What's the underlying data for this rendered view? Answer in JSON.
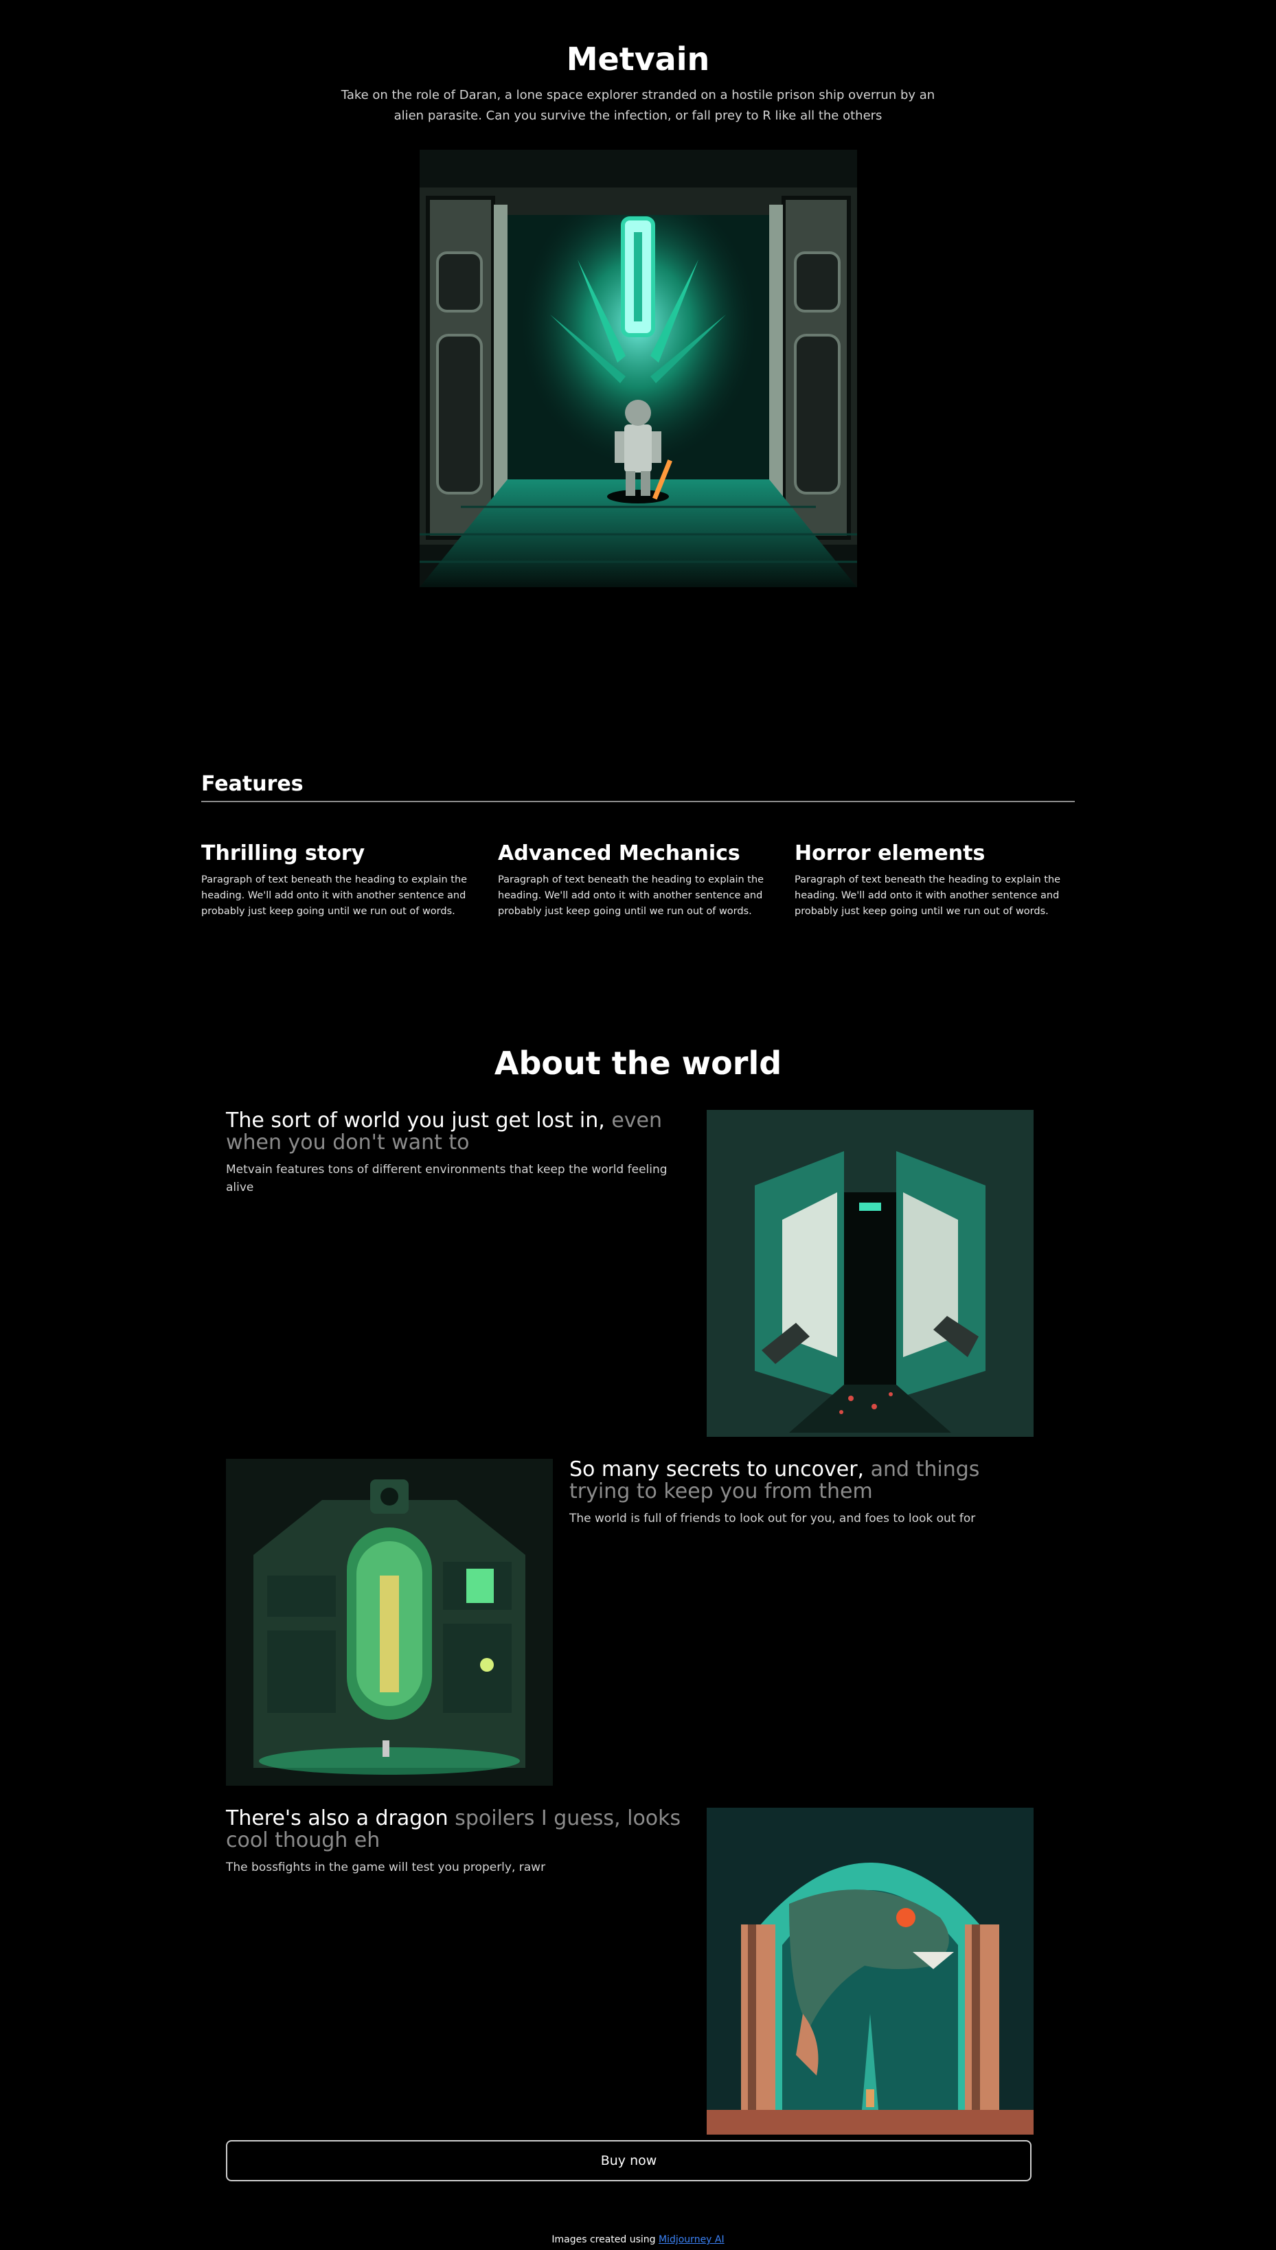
{
  "hero": {
    "title": "Metvain",
    "subtitle": "Take on the role of Daran, a lone space explorer stranded on a hostile prison ship overrun by an alien parasite. Can you survive the infection, or fall prey to R like all the others"
  },
  "features": {
    "heading": "Features",
    "items": [
      {
        "title": "Thrilling story",
        "text": "Paragraph of text beneath the heading to explain the heading. We'll add onto it with another sentence and probably just keep going until we run out of words."
      },
      {
        "title": "Advanced Mechanics",
        "text": "Paragraph of text beneath the heading to explain the heading. We'll add onto it with another sentence and probably just keep going until we run out of words."
      },
      {
        "title": "Horror elements",
        "text": "Paragraph of text beneath the heading to explain the heading. We'll add onto it with another sentence and probably just keep going until we run out of words."
      }
    ]
  },
  "about": {
    "title": "About the world",
    "rows": [
      {
        "heading": "The sort of world you just get lost in,",
        "heading_muted": "even when you don't want to",
        "text": "Metvain features tons of different environments that keep the world feeling alive"
      },
      {
        "heading": "So many secrets to uncover,",
        "heading_muted": "and things trying to keep you from them",
        "text": "The world is full of friends to look out for you, and foes to look out for"
      },
      {
        "heading": "There's also a dragon",
        "heading_muted": "spoilers I guess, looks cool though eh",
        "text": "The bossfights in the game will test you properly, rawr"
      }
    ]
  },
  "buy": {
    "label": "Buy now"
  },
  "footer": {
    "prefix": "Images created using",
    "link": "Midjourney AI"
  },
  "colors": {
    "background": "#000000",
    "accent": "#2fd4aa",
    "muted_text": "#8c8c8c",
    "link": "#3b82f6"
  }
}
